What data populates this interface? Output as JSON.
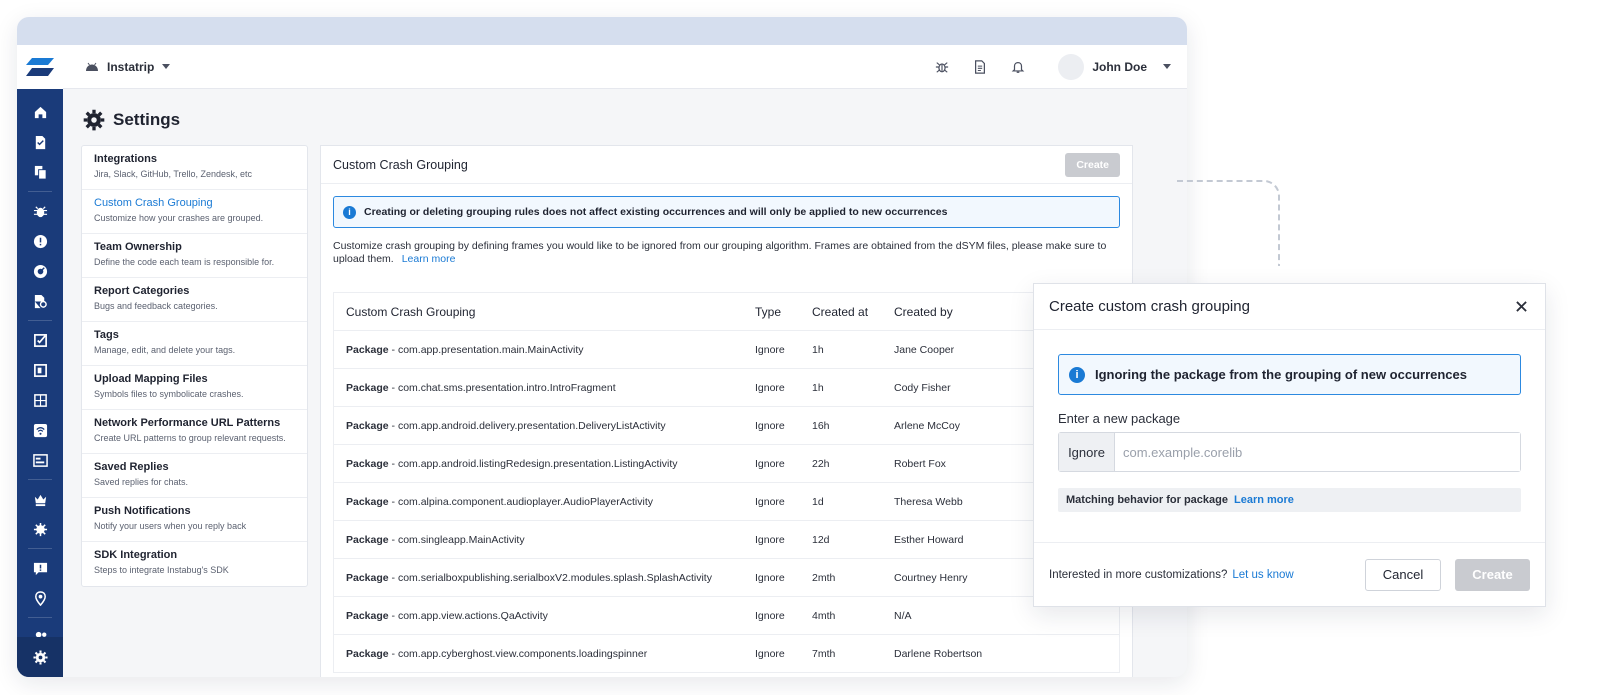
{
  "colors": {
    "rail": "#1a3b7a",
    "accent": "#1a7ad4",
    "disabled": "#c9cbd0"
  },
  "topbar": {
    "app_name": "Instatrip",
    "user_name": "John Doe"
  },
  "rail_icons": [
    "home-icon",
    "document-icon",
    "copy-icon",
    "bug-icon",
    "alert-icon",
    "gauge-icon",
    "search-file-icon",
    "check-square-icon",
    "layout-icon",
    "grid-icon",
    "wifi-icon",
    "card-icon",
    "crown-icon",
    "settings-sun-icon",
    "chat-icon",
    "location-icon",
    "users-icon",
    "gear-icon"
  ],
  "page": {
    "title": "Settings"
  },
  "settings_nav": [
    {
      "title": "Integrations",
      "desc": "Jira, Slack, GitHub, Trello, Zendesk, etc"
    },
    {
      "title": "Custom Crash Grouping",
      "desc": "Customize how your crashes are grouped."
    },
    {
      "title": "Team Ownership",
      "desc": "Define the code each team is responsible for."
    },
    {
      "title": "Report Categories",
      "desc": "Bugs and feedback categories."
    },
    {
      "title": "Tags",
      "desc": "Manage, edit, and delete your tags."
    },
    {
      "title": "Upload Mapping Files",
      "desc": "Symbols files to symbolicate crashes."
    },
    {
      "title": "Network Performance URL Patterns",
      "desc": "Create URL patterns to group relevant requests."
    },
    {
      "title": "Saved Replies",
      "desc": "Saved replies for chats."
    },
    {
      "title": "Push Notifications",
      "desc": "Notify your users when you reply back"
    },
    {
      "title": "SDK Integration",
      "desc": "Steps to integrate Instabug's SDK"
    }
  ],
  "panel": {
    "title": "Custom Crash Grouping",
    "create_label": "Create",
    "alert": "Creating or deleting grouping rules does not affect existing occurrences and will only be applied to new occurrences",
    "description": "Customize crash grouping by defining frames you would like to be ignored from our grouping algorithm. Frames are obtained from the dSYM files, please make sure to upload them.",
    "learn_more": "Learn more"
  },
  "table": {
    "headers": [
      "Custom Crash Grouping",
      "Type",
      "Created at",
      "Created by"
    ],
    "rows": [
      {
        "kind": "Package",
        "name": " - com.app.presentation.main.MainActivity",
        "type": "Ignore",
        "created_at": "1h",
        "created_by": "Jane Cooper"
      },
      {
        "kind": "Package",
        "name": " - com.chat.sms.presentation.intro.IntroFragment",
        "type": "Ignore",
        "created_at": "1h",
        "created_by": "Cody Fisher"
      },
      {
        "kind": "Package",
        "name": " - com.app.android.delivery.presentation.DeliveryListActivity",
        "type": "Ignore",
        "created_at": "16h",
        "created_by": "Arlene McCoy"
      },
      {
        "kind": "Package",
        "name": " - com.app.android.listingRedesign.presentation.ListingActivity",
        "type": "Ignore",
        "created_at": "22h",
        "created_by": "Robert Fox"
      },
      {
        "kind": "Package",
        "name": " - com.alpina.component.audioplayer.AudioPlayerActivity",
        "type": "Ignore",
        "created_at": "1d",
        "created_by": "Theresa Webb"
      },
      {
        "kind": "Package",
        "name": " - com.singleapp.MainActivity",
        "type": "Ignore",
        "created_at": "12d",
        "created_by": "Esther Howard"
      },
      {
        "kind": "Package",
        "name": " - com.serialboxpublishing.serialboxV2.modules.splash.SplashActivity",
        "type": "Ignore",
        "created_at": "2mth",
        "created_by": "Courtney Henry"
      },
      {
        "kind": "Package",
        "name": " - com.app.view.actions.QaActivity",
        "type": "Ignore",
        "created_at": "4mth",
        "created_by": "N/A"
      },
      {
        "kind": "Package",
        "name": " - com.app.cyberghost.view.components.loadingspinner",
        "type": "Ignore",
        "created_at": "7mth",
        "created_by": "Darlene Robertson"
      }
    ]
  },
  "modal": {
    "title": "Create custom crash grouping",
    "alert": "Ignoring the package from the grouping of new occurrences",
    "field_label": "Enter a new package",
    "prefix": "Ignore",
    "placeholder": "com.example.corelib",
    "value": "",
    "matching_label": "Matching behavior for package",
    "learn_more": "Learn more",
    "footer_text": "Interested in more customizations?",
    "footer_link": "Let us know",
    "cancel_label": "Cancel",
    "create_label": "Create"
  }
}
